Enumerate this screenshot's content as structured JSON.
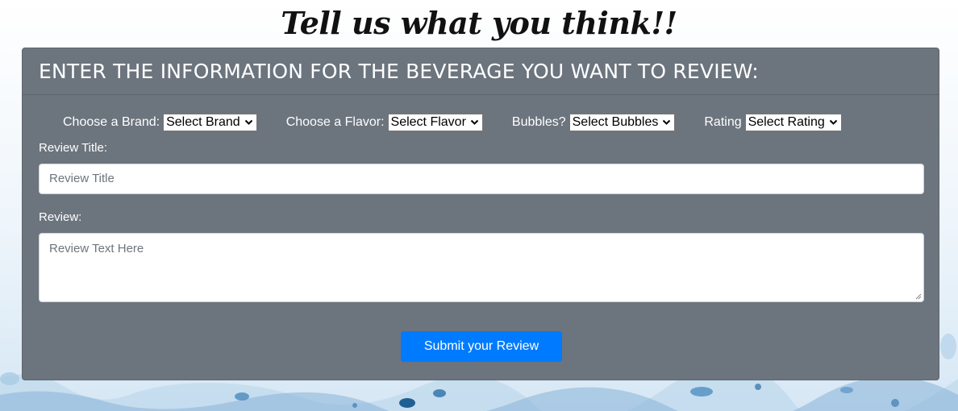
{
  "page": {
    "title": "Tell us what you think!!"
  },
  "form": {
    "heading": "ENTER THE INFORMATION FOR THE BEVERAGE YOU WANT TO REVIEW:",
    "brand": {
      "label": "Choose a Brand:",
      "selected": "Select Brand"
    },
    "flavor": {
      "label": "Choose a Flavor:",
      "selected": "Select Flavor"
    },
    "bubbles": {
      "label": "Bubbles?",
      "selected": "Select Bubbles"
    },
    "rating": {
      "label": "Rating",
      "selected": "Select Rating"
    },
    "review_title": {
      "label": "Review Title:",
      "placeholder": "Review Title",
      "value": ""
    },
    "review_text": {
      "label": "Review:",
      "placeholder": "Review Text Here",
      "value": ""
    },
    "submit_label": "Submit your Review"
  },
  "colors": {
    "card_background": "#6c747e",
    "button_primary": "#007bff",
    "splash_accent": "#2a6fa8"
  },
  "icons": {
    "select_arrow": "chevron-down-icon",
    "textarea_grip": "resize-grip-icon"
  }
}
